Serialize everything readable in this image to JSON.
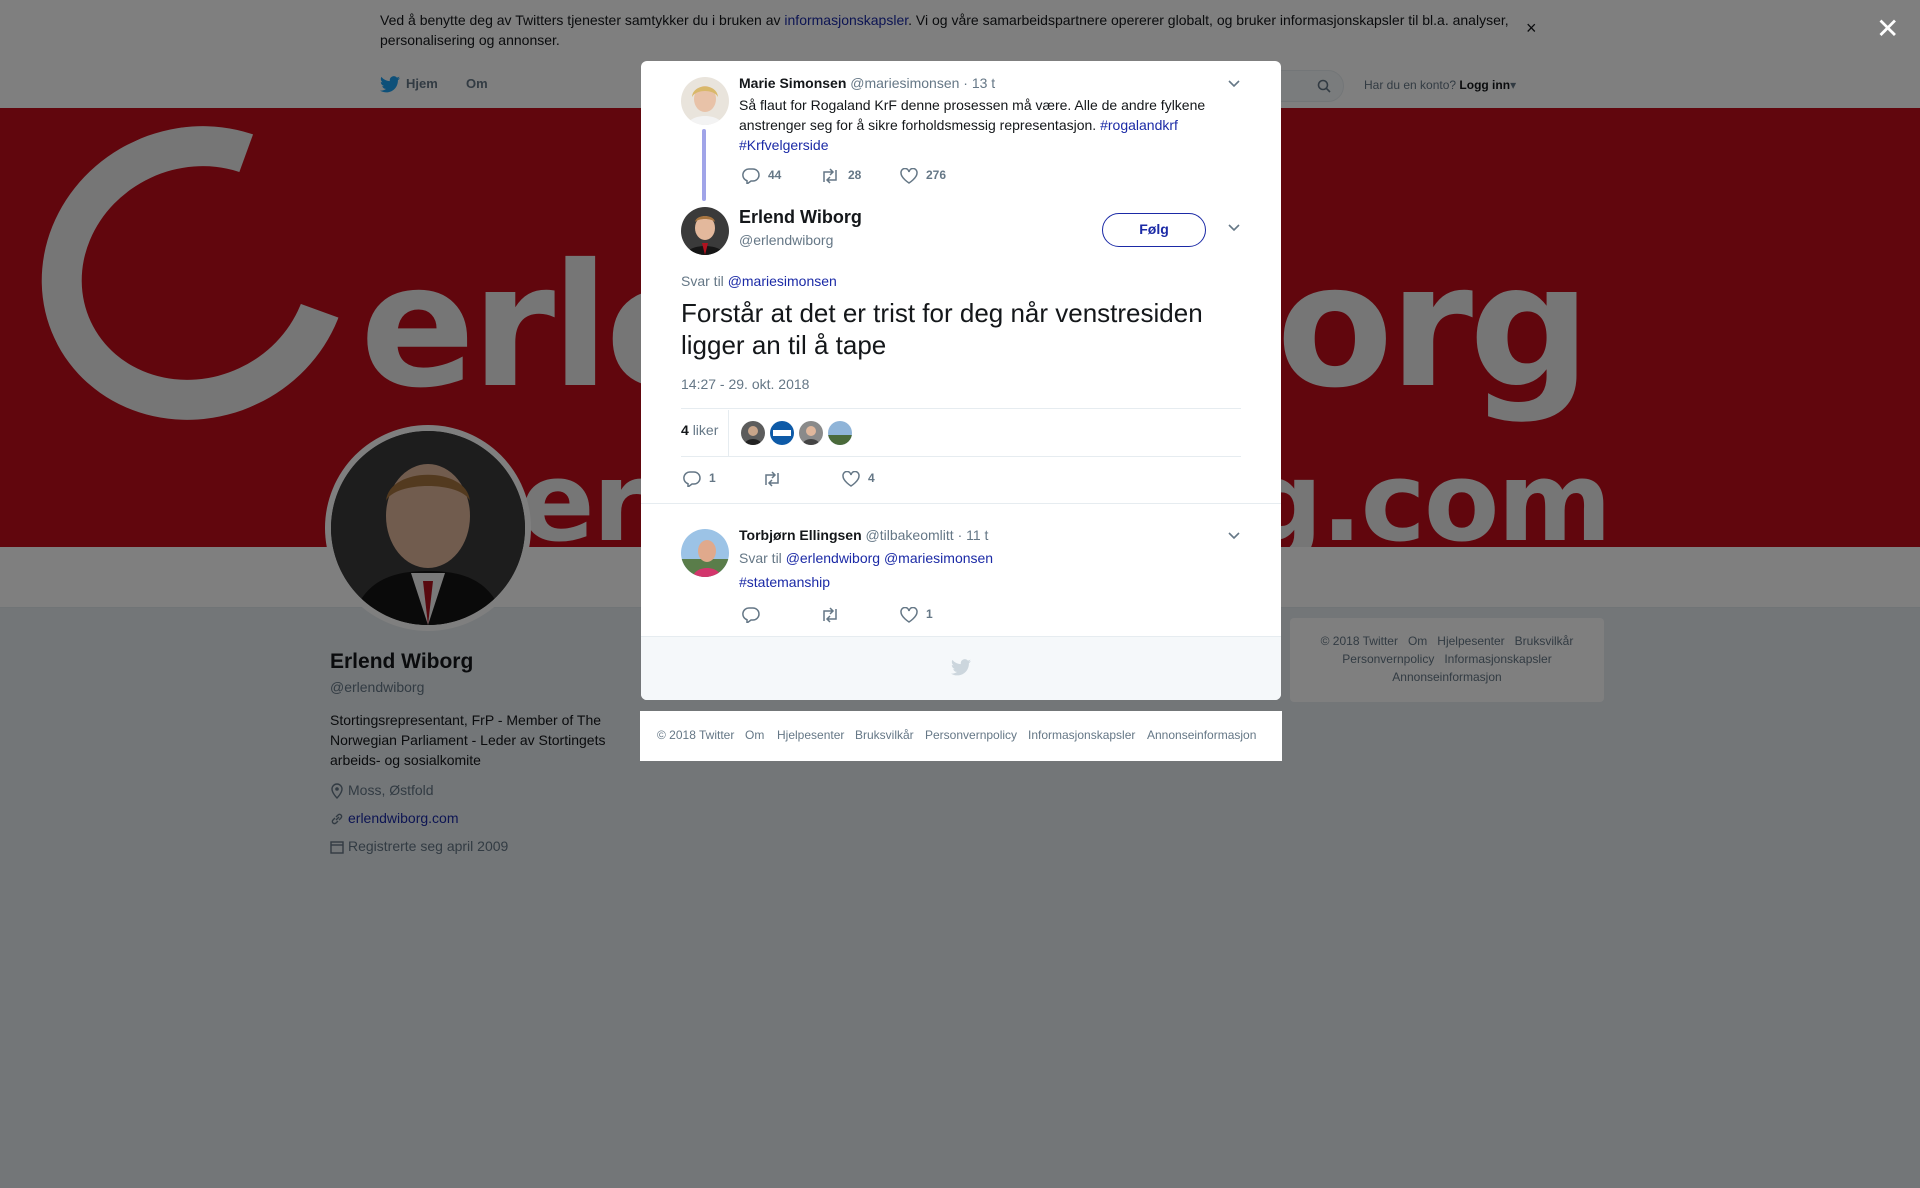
{
  "cookie": {
    "text_before": "Ved å benytte deg av Twitters tjenester samtykker du i bruken av ",
    "link": "informasjonskapsler",
    "text_after": ". Vi og våre samarbeidspartnere opererer globalt, og bruker informasjonskapsler til bl.a. analyser, personalisering og annonser.",
    "close": "×"
  },
  "nav": {
    "home": "Hjem",
    "about": "Om",
    "login_hint": "Har du en konto?",
    "login": "Logg inn"
  },
  "banner": {
    "line1": "erlendwiborg",
    "line2": "erlendwiborg.com"
  },
  "profile": {
    "name": "Erlend Wiborg",
    "handle": "@erlendwiborg",
    "bio": "Stortingsrepresentant, FrP - Member of The Norwegian Parliament - Leder av Stortingets arbeids- og sosialkomite",
    "location": "Moss, Østfold",
    "website": "erlendwiborg.com",
    "joined": "Registrerte seg april 2009"
  },
  "side_footer": {
    "row1": [
      "© 2018 Twitter",
      "Om",
      "Hjelpesenter",
      "Bruksvilkår"
    ],
    "row2": [
      "Personvernpolicy",
      "Informasjonskapsler"
    ],
    "row3": [
      "Annonseinformasjon"
    ]
  },
  "overlay_close": "✕",
  "parent_tweet": {
    "name": "Marie Simonsen",
    "handle": "@mariesimonsen",
    "time": "· 13 t",
    "text": "Så flaut for Rogaland KrF denne prosessen må være. Alle de andre fylkene anstrenger seg for å sikre forholdsmessig representasjon. ",
    "hashtag1": "#rogalandkrf",
    "hashtag2": "#Krfvelgerside",
    "replies": "44",
    "retweets": "28",
    "likes": "276"
  },
  "main_tweet": {
    "name": "Erlend Wiborg",
    "handle": "@erlendwiborg",
    "follow": "Følg",
    "reply_to_label": "Svar til ",
    "reply_to": "@mariesimonsen",
    "text": "Forstår at det er trist for deg når venstresiden ligger an til å tape",
    "timestamp": "14:27 - 29. okt. 2018",
    "likes_count": "4",
    "likes_label": "liker",
    "replies": "1",
    "retweets": "",
    "likes": "4"
  },
  "reply_tweet": {
    "name": "Torbjørn Ellingsen",
    "handle": "@tilbakeomlitt",
    "time": "· 11 t",
    "reply_to_label": "Svar til ",
    "mention1": "@erlendwiborg",
    "mention2": "@mariesimonsen",
    "hashtag": "#statemanship",
    "replies": "",
    "retweets": "",
    "likes": "1"
  },
  "bottom_footer": [
    "© 2018 Twitter",
    "Om",
    "Hjelpesenter",
    "Bruksvilkår",
    "Personvernpolicy",
    "Informasjonskapsler",
    "Annonseinformasjon"
  ],
  "colors": {
    "link": "#1b2aa6",
    "banner": "#c20d1a",
    "twitter_blue": "#1da1f2"
  }
}
